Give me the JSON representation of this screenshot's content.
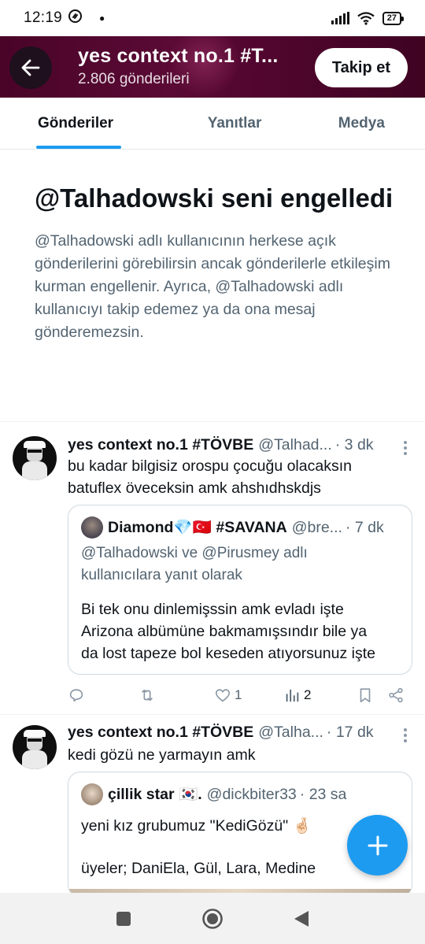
{
  "status_bar": {
    "time": "12:19",
    "battery": "27",
    "app_icon": "shazam-like-icon",
    "signal_icon": "cell-signal-icon",
    "wifi_icon": "wifi-icon"
  },
  "header": {
    "title": "yes context no.1 #T...",
    "subtitle": "2.806 gönderileri",
    "follow_label": "Takip et",
    "background_color": "#4e062c"
  },
  "tabs": [
    {
      "label": "Gönderiler",
      "active": true
    },
    {
      "label": "Yanıtlar",
      "active": false
    },
    {
      "label": "Medya",
      "active": false
    }
  ],
  "blocked": {
    "title": "@Talhadowski seni engelledi",
    "body": "@Talhadowski adlı kullanıcının herkese açık gönderilerini görebilirsin ancak gönderilerle etkileşim kurman engellenir. Ayrıca, @Talhadowski adlı kullanıcıyı takip edemez ya da ona mesaj gönderemezsin."
  },
  "tweets": [
    {
      "name": "yes context no.1 #TÖVBE",
      "handle": "@Talhad...",
      "time": "· 3 dk",
      "text_line1": "bu kadar bilgisiz orospu çocuğu olacaksın",
      "text_line2": "batuflex öveceksin amk ahshıdhskdjs",
      "quote": {
        "name": "Diamond💎🇹🇷 #SAVANA",
        "handle": "@bre...",
        "time": "· 7 dk",
        "reply_line1": "@Talhadowski ve @Pirusmey adlı",
        "reply_line2": "kullanıcılara yanıt olarak",
        "text": "Bi tek onu dinlemişssin amk evladı işte\nArizona albümüne bakmamışsındır bile  ya\nda lost tapeze bol keseden atıyorsunuz işte"
      },
      "actions": {
        "reply_count": "",
        "retweet_count": "",
        "like_count": "1",
        "views_count": "2"
      }
    },
    {
      "name": "yes context no.1 #TÖVBE",
      "handle": "@Talha...",
      "time": "· 17 dk",
      "text_line1": "kedi gözü ne yarmayın amk",
      "quote": {
        "name": "çillik star 🇰🇷.",
        "handle": "@dickbiter33",
        "time": "· 23 sa",
        "text_line1": "yeni kız grubumuz \"KediGözü\" 🤞🏻",
        "text_line2": "üyeler; DaniEla, Gül, Lara, Medine"
      }
    }
  ],
  "fab": {
    "icon": "plus-icon",
    "color": "#1d9bf0"
  },
  "navbar": {
    "items": [
      "recents-button",
      "home-button",
      "back-button"
    ]
  }
}
